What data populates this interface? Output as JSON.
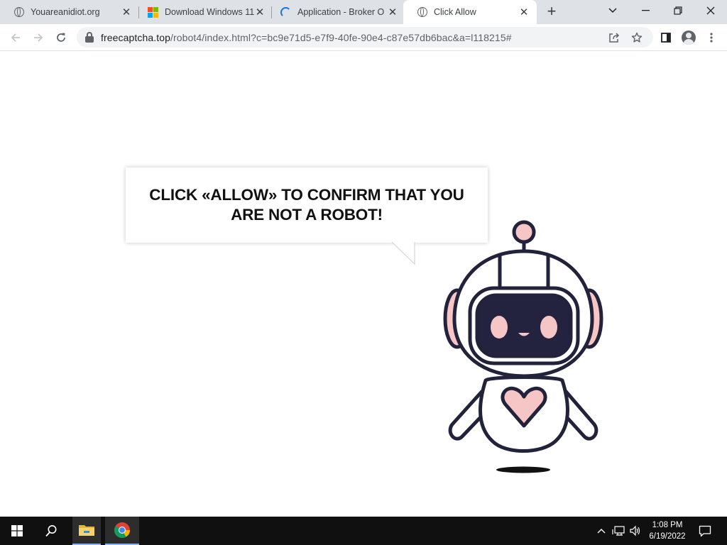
{
  "browser": {
    "tabs": [
      {
        "title": "Youareanidiot.org",
        "icon": "globe-icon"
      },
      {
        "title": "Download Windows 11",
        "icon": "windows-logo-icon"
      },
      {
        "title": "Application - Broker O",
        "icon": "loading-spinner-icon"
      },
      {
        "title": "Click Allow",
        "icon": "globe-icon",
        "active": true
      }
    ],
    "new_tab_symbol": "+",
    "address": {
      "domain": "freecaptcha.top",
      "path": "/robot4/index.html?c=bc9e71d5-e7f9-40fe-90e4-c87e57db6bac&a=l118215#"
    }
  },
  "page": {
    "message": "CLICK «ALLOW» TO CONFIRM THAT YOU ARE NOT A ROBOT!"
  },
  "colors": {
    "robot_outline": "#22223a",
    "robot_pink": "#f6c5c5",
    "robot_visor": "#23233f",
    "tabstrip_bg": "#dee1e6",
    "taskbar_bg": "#101010"
  },
  "taskbar": {
    "time": "1:08 PM",
    "date": "6/19/2022"
  }
}
